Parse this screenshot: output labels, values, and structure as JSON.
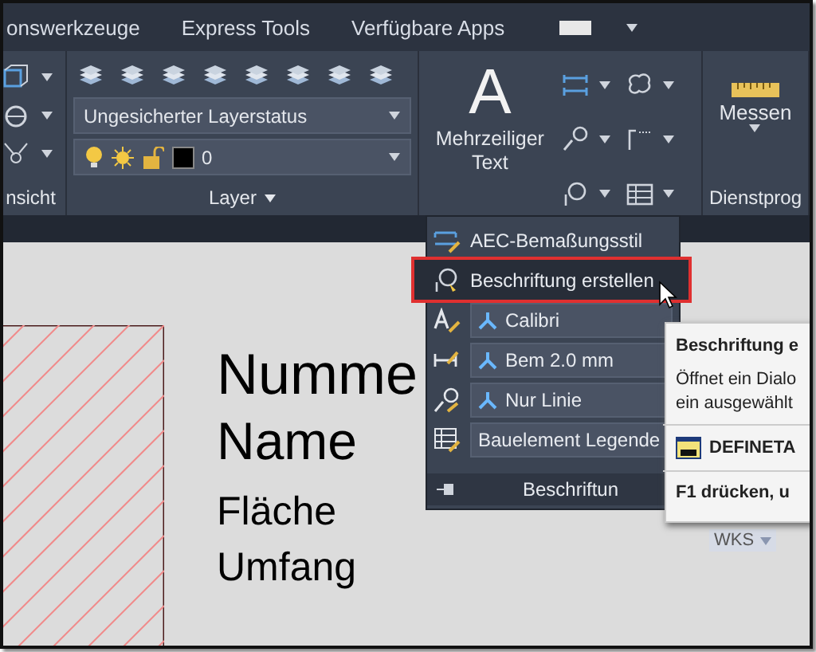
{
  "tabs": [
    {
      "label": "onswerkzeuge",
      "selected": false
    },
    {
      "label": "Express Tools",
      "selected": false
    },
    {
      "label": "Verfügbare Apps",
      "selected": false
    }
  ],
  "ribbon": {
    "panels": [
      {
        "kind": "view",
        "title": "nsicht"
      },
      {
        "kind": "layer",
        "title": "Layer",
        "layer_state": "Ungesicherter Layerstatus",
        "current_layer": "0"
      },
      {
        "kind": "annotation",
        "big_button": "Mehrzeiliger Text",
        "big_glyph": "A"
      },
      {
        "kind": "utilities",
        "big_button": "Messen",
        "title": "Dienstprog"
      }
    ]
  },
  "canvas": {
    "labels": [
      "Numme",
      "Name",
      "Fläche",
      "Umfang"
    ],
    "ucs": "WKS"
  },
  "dropdown": {
    "items": [
      {
        "kind": "command",
        "label": "AEC-Bemaßungsstil",
        "selected": false
      },
      {
        "kind": "command",
        "label": "Beschriftung erstellen",
        "selected": true
      },
      {
        "kind": "style",
        "label": "Calibri"
      },
      {
        "kind": "style",
        "label": "Bem 2.0 mm"
      },
      {
        "kind": "style",
        "label": "Nur Linie"
      },
      {
        "kind": "combo",
        "label": "Bauelement Legende"
      }
    ],
    "footer": "Beschriftun"
  },
  "tooltip": {
    "title": "Beschriftung e",
    "description": [
      "Öffnet ein Dialo",
      "ein ausgewählt"
    ],
    "command": "DEFINETA",
    "help": "F1 drücken, u"
  }
}
